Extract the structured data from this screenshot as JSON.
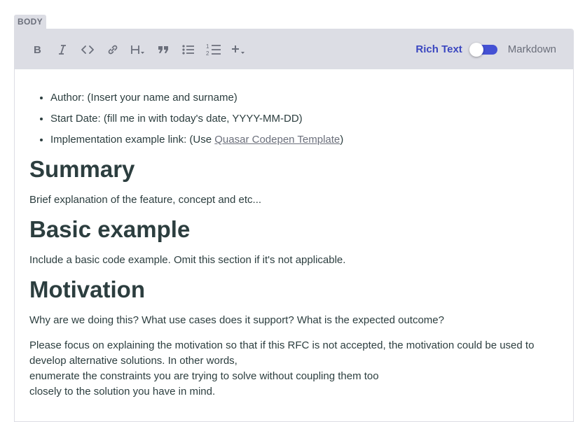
{
  "field": {
    "label": "BODY"
  },
  "toolbar": {
    "buttons": [
      {
        "name": "bold-button",
        "icon": "bold-icon"
      },
      {
        "name": "italic-button",
        "icon": "italic-icon"
      },
      {
        "name": "code-button",
        "icon": "code-icon"
      },
      {
        "name": "link-button",
        "icon": "link-icon"
      },
      {
        "name": "heading-button",
        "icon": "heading-dropdown-icon"
      },
      {
        "name": "quote-button",
        "icon": "quote-icon"
      },
      {
        "name": "bullet-list-button",
        "icon": "bullet-list-icon"
      },
      {
        "name": "numbered-list-button",
        "icon": "numbered-list-icon"
      },
      {
        "name": "insert-more-button",
        "icon": "plus-dropdown-icon"
      }
    ],
    "mode_rich": "Rich Text",
    "mode_markdown": "Markdown",
    "accent_color": "#4451d4"
  },
  "content": {
    "list": {
      "author": "Author: (Insert your name and surname)",
      "start_date": "Start Date: (fill me in with today's date, YYYY-MM-DD)",
      "impl_prefix": "Implementation example link: (Use ",
      "impl_link": "Quasar Codepen Template",
      "impl_suffix": ")"
    },
    "summary_heading": "Summary",
    "summary_text": "Brief explanation of the feature, concept and etc...",
    "basic_heading": "Basic example",
    "basic_text": "Include a basic code example. Omit this section if it's not applicable.",
    "motivation_heading": "Motivation",
    "motivation_text": "Why are we doing this? What use cases does it support? What is the expected outcome?",
    "motivation_para_1": "Please focus on explaining the motivation so that if this RFC is not accepted, the motivation could be used to develop alternative solutions. In other words,",
    "motivation_para_2": "enumerate the constraints you are trying to solve without coupling them too",
    "motivation_para_3": "closely to the solution you have in mind."
  }
}
